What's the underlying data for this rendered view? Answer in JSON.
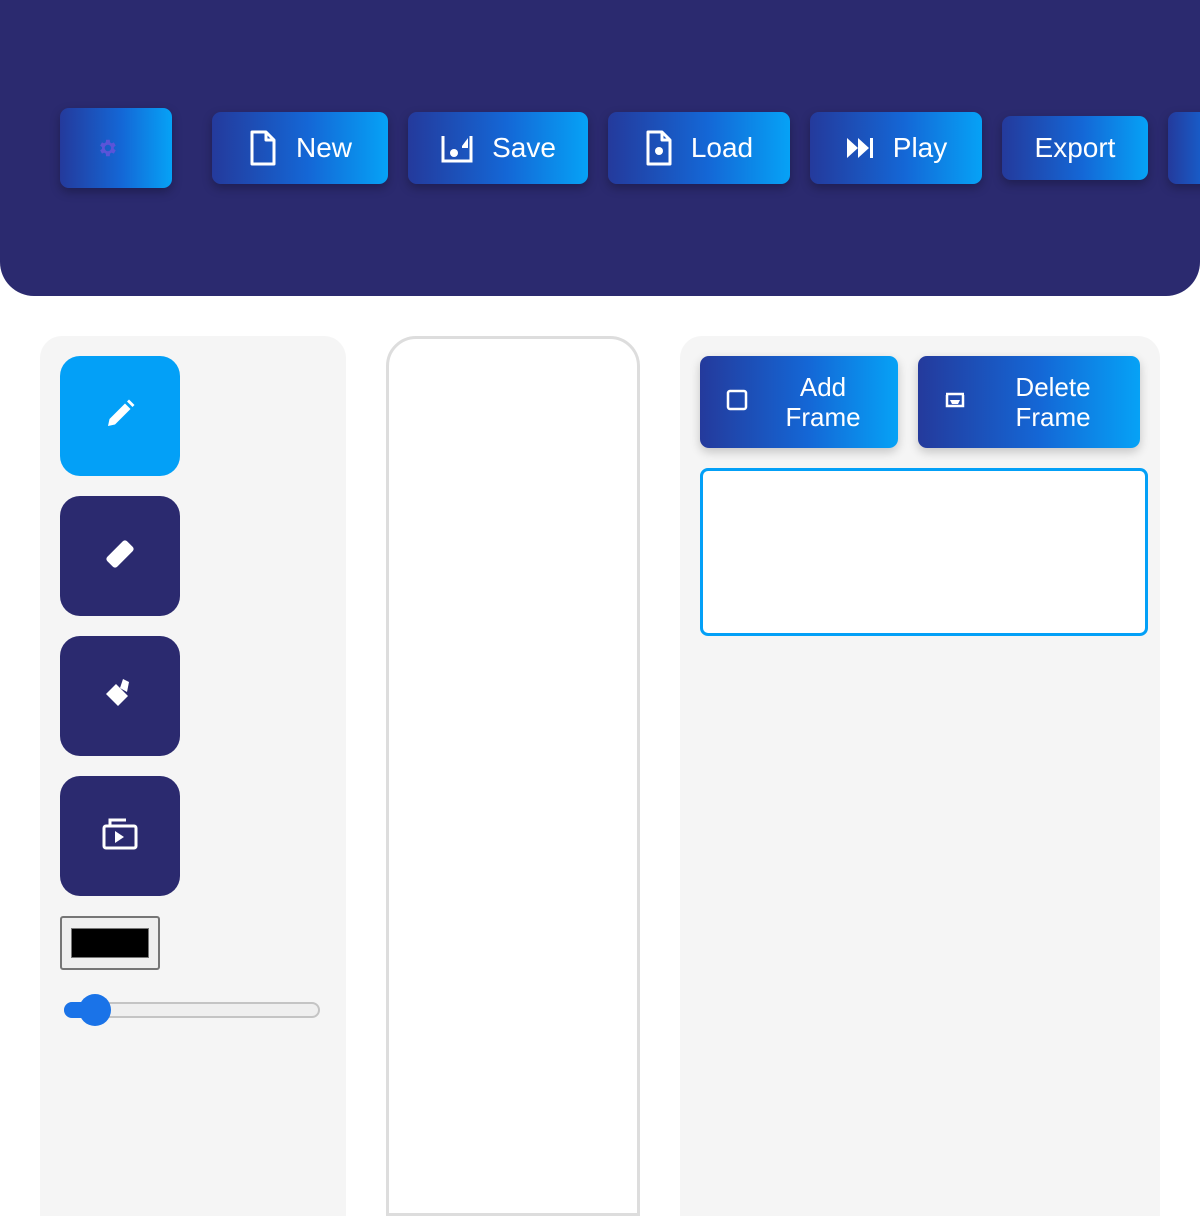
{
  "toolbar": {
    "buttons": [
      {
        "id": "settings",
        "label": "",
        "icon": "gear-icon"
      },
      {
        "id": "new",
        "label": "New",
        "icon": "file-icon"
      },
      {
        "id": "save",
        "label": "Save",
        "icon": "save-icon"
      },
      {
        "id": "load",
        "label": "Load",
        "icon": "file-open-icon"
      },
      {
        "id": "play",
        "label": "Play",
        "icon": "skip-forward-icon"
      },
      {
        "id": "export",
        "label": "Export",
        "icon": ""
      }
    ]
  },
  "tools": [
    {
      "id": "pencil",
      "icon": "pencil-icon",
      "active": true
    },
    {
      "id": "eraser",
      "icon": "eraser-icon",
      "active": false
    },
    {
      "id": "fill",
      "icon": "paint-bucket-icon",
      "active": false
    },
    {
      "id": "onion-skin",
      "icon": "layers-play-icon",
      "active": false
    }
  ],
  "brush": {
    "color": "#000000",
    "size_fraction": 0.12
  },
  "frames": {
    "add_label": "Add\nFrame",
    "delete_label": "Delete\nFrame"
  },
  "colors": {
    "toolbar_bg": "#2b2a6f",
    "accent": "#03a0f7",
    "tool_bg": "#2b2a6f",
    "panel_bg": "#f5f5f5"
  }
}
